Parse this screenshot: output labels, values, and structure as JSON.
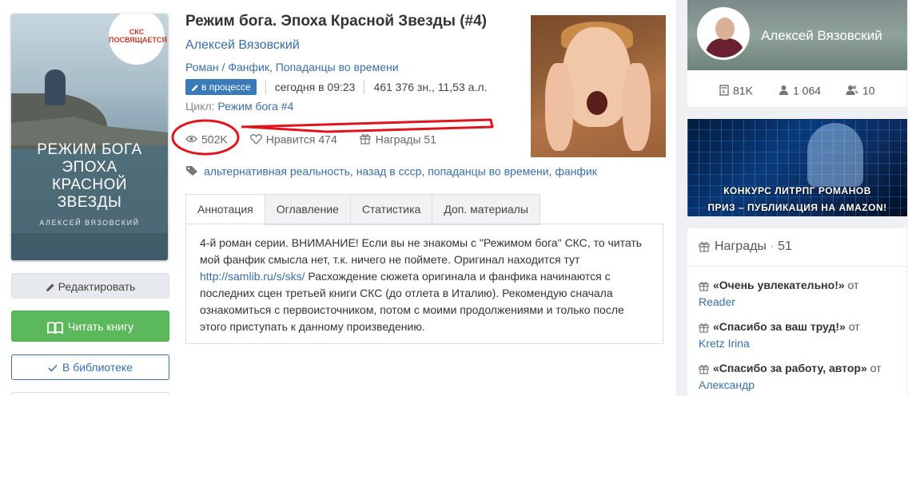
{
  "cover": {
    "badge": "СКС ПОСВЯЩАЕТСЯ",
    "title_line1": "РЕЖИМ БОГА",
    "title_line2": "ЭПОХА",
    "title_line3": "КРАСНОЙ",
    "title_line4": "ЗВЕЗДЫ",
    "author": "АЛЕКСЕЙ ВЯЗОВСКИЙ"
  },
  "actions": {
    "edit": "Редактировать",
    "read": "Читать книгу",
    "library": "В библиотеке"
  },
  "book": {
    "title": "Режим бога. Эпоха Красной Звезды (#4)",
    "author": "Алексей Вязовский",
    "genre1": "Роман / Фанфик",
    "genre2": "Попаданцы во времени",
    "status": "в процессе",
    "updated": "сегодня в 09:23",
    "size": "461 376 зн., 11,53 а.л.",
    "cycle_label": "Цикл:",
    "cycle": "Режим бога #4",
    "views": "502K",
    "likes": "Нравится 474",
    "awards": "Награды 51",
    "tags": [
      "альтернативная реальность",
      "назад в ссср",
      "попаданцы во времени",
      "фанфик"
    ]
  },
  "tabs": [
    "Аннотация",
    "Оглавление",
    "Статистика",
    "Доп. материалы"
  ],
  "annotation": {
    "part1": "4-й роман серии. ВНИМАНИЕ! Если вы не знакомы с \"Режимом бога\" СКС, то читать мой фанфик смысла нет, т.к. ничего не поймете. Оригинал находится тут ",
    "link": "http://samlib.ru/s/sks/",
    "part2": " Расхождение сюжета оригинала и фанфика начинаются с последних сцен третьей книги СКС (до отлета в Италию). Рекомендую сначала ознакомиться с первоисточником, потом с моими продолжениями и только после этого приступать к данному произведению."
  },
  "profile": {
    "name": "Алексей Вязовский",
    "books": "81K",
    "followers": "1 064",
    "friends": "10"
  },
  "banner": {
    "line1": "КОНКУРС ЛИТРПГ РОМАНОВ",
    "line2": "ПРИЗ – ПУБЛИКАЦИЯ НА AMAZON!"
  },
  "awards_panel": {
    "title": "Награды",
    "count": "51",
    "from": "от",
    "items": [
      {
        "name": "«Очень увлекательно!»",
        "user": "Reader"
      },
      {
        "name": "«Спасибо за ваш труд!»",
        "user": "Kretz Irina"
      },
      {
        "name": "«Спасибо за работу, автор»",
        "user": "Александр"
      }
    ]
  },
  "colors": {
    "link": "#3a6ea5",
    "read_button": "#5cb85c",
    "status_badge": "#3a7ab8",
    "annotation_mark": "#e0141e"
  },
  "icons": [
    "pencil-icon",
    "book-icon",
    "check-icon",
    "eye-icon",
    "heart-icon",
    "gift-icon",
    "tag-icon",
    "books-icon",
    "user-icon",
    "users-icon"
  ]
}
